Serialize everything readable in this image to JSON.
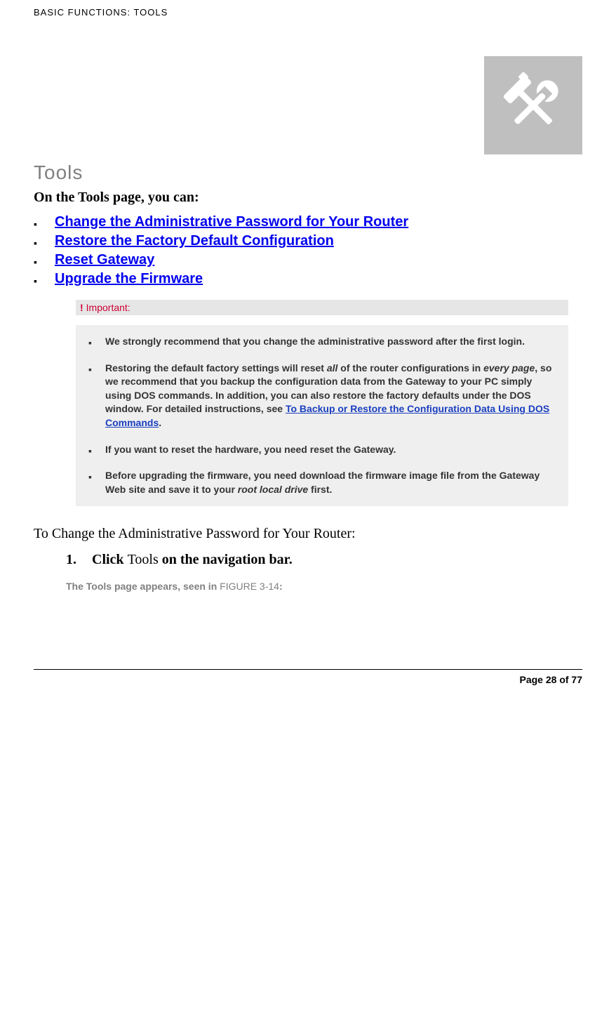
{
  "header": {
    "breadcrumb": "BASIC FUNCTIONS: TOOLS"
  },
  "title": "Tools",
  "intro": "On the Tools page, you can:",
  "links": [
    "Change the Administrative Password for Your Router",
    "Restore the Factory Default Configuration",
    "Reset Gateway",
    "Upgrade the Firmware"
  ],
  "important": {
    "label": "Important:",
    "items": {
      "i1": {
        "text": "We strongly recommend that you change the administrative password after the first login."
      },
      "i2": {
        "pre": "Restoring the default factory settings will reset ",
        "em1": "all",
        "mid1": " of the router configurations in ",
        "em2": "every page",
        "mid2": ", so we recommend that you backup the configuration data from the Gateway to your PC simply using DOS commands. In addition, you can also restore the factory defaults under the DOS window. For detailed instructions, see ",
        "link": "To Backup or Restore the Configuration Data Using DOS Commands",
        "post": "."
      },
      "i3": {
        "text": "If you want to reset the hardware, you need reset the Gateway."
      },
      "i4": {
        "pre": "Before upgrading the firmware, you need download the firmware image file from the Gateway Web site and save it to your ",
        "em": "root local drive",
        "post": " first."
      }
    }
  },
  "section_head": "To Change the Administrative Password for Your Router:",
  "step1": {
    "num": "1.",
    "b1": "Click ",
    "plain": "Tools",
    "b2": " on the navigation bar."
  },
  "result": {
    "pre": "The Tools page appears, seen in ",
    "fig": "FIGURE 3-14",
    "post": ":"
  },
  "footer": "Page 28 of 77",
  "icons": {
    "tools": "tools-icon"
  }
}
